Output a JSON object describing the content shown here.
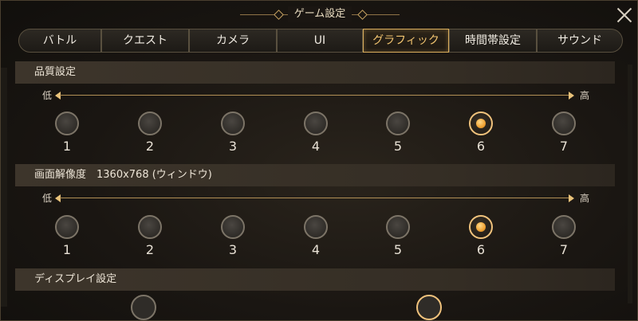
{
  "window": {
    "title": "ゲーム設定"
  },
  "tabs": [
    {
      "label": "バトル",
      "active": false
    },
    {
      "label": "クエスト",
      "active": false
    },
    {
      "label": "カメラ",
      "active": false
    },
    {
      "label": "UI",
      "active": false
    },
    {
      "label": "グラフィック",
      "active": true
    },
    {
      "label": "時間帯設定",
      "active": false
    },
    {
      "label": "サウンド",
      "active": false
    }
  ],
  "quality": {
    "header": "品質設定",
    "low_label": "低",
    "high_label": "高",
    "options": [
      "1",
      "2",
      "3",
      "4",
      "5",
      "6",
      "7"
    ],
    "selected": "6"
  },
  "resolution": {
    "header": "画面解像度　1360x768 (ウィンドウ)",
    "low_label": "低",
    "high_label": "高",
    "options": [
      "1",
      "2",
      "3",
      "4",
      "5",
      "6",
      "7"
    ],
    "selected": "6"
  },
  "display": {
    "header": "ディスプレイ設定"
  },
  "icons": {
    "close": "close-icon",
    "arrow_left": "arrow-left-icon",
    "arrow_right": "arrow-right-icon"
  },
  "colors": {
    "accent": "#f0a233",
    "active_tab_border": "#d9ad5c",
    "background": "#16130f"
  }
}
